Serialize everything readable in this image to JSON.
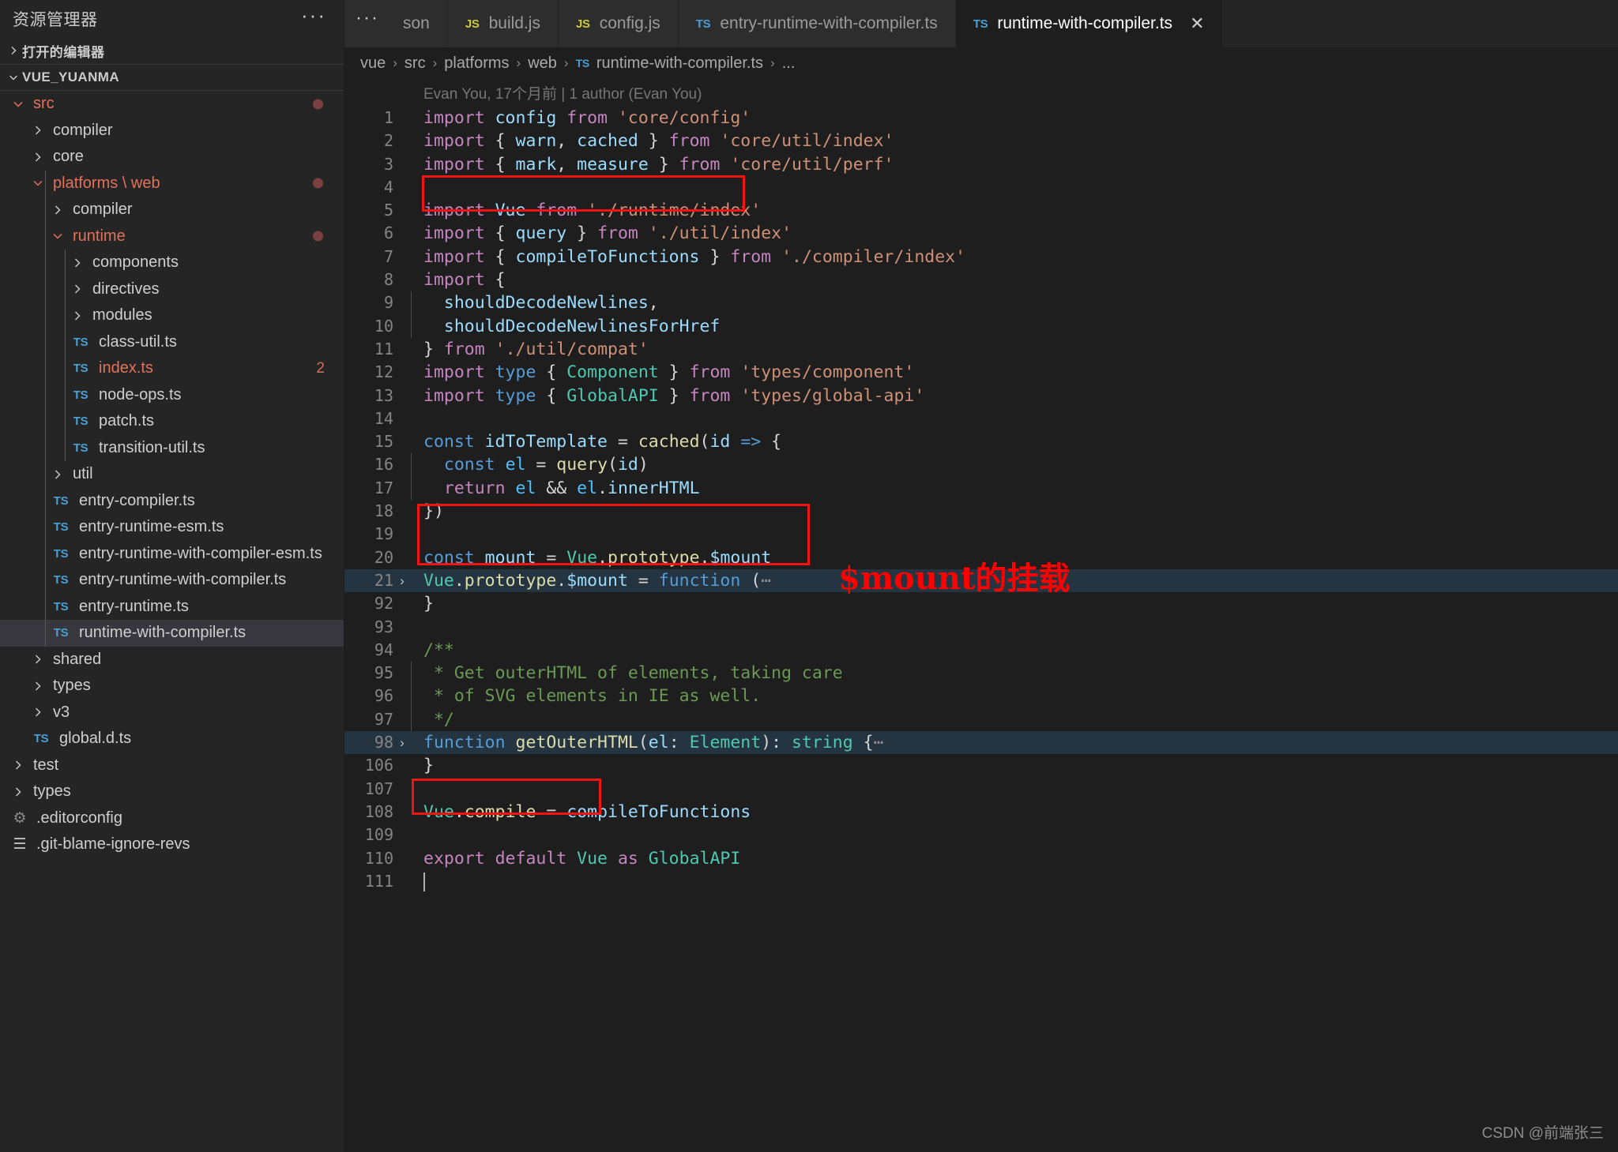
{
  "sidebar": {
    "title": "资源管理器",
    "more_label": "···",
    "open_editors_label": "打开的编辑器",
    "workspace_label": "VUE_YUANMA",
    "tree": [
      {
        "label": "src",
        "type": "folder",
        "expanded": true,
        "indent": 1,
        "modified": true,
        "badge_dot": true
      },
      {
        "label": "compiler",
        "type": "folder",
        "expanded": false,
        "indent": 2
      },
      {
        "label": "core",
        "type": "folder",
        "expanded": false,
        "indent": 2
      },
      {
        "label": "platforms \\ web",
        "type": "folder",
        "expanded": true,
        "indent": 2,
        "modified": true,
        "badge_dot": true
      },
      {
        "label": "compiler",
        "type": "folder",
        "expanded": false,
        "indent": 3
      },
      {
        "label": "runtime",
        "type": "folder",
        "expanded": true,
        "indent": 3,
        "modified": true,
        "badge_dot": true
      },
      {
        "label": "components",
        "type": "folder",
        "expanded": false,
        "indent": 4
      },
      {
        "label": "directives",
        "type": "folder",
        "expanded": false,
        "indent": 4
      },
      {
        "label": "modules",
        "type": "folder",
        "expanded": false,
        "indent": 4
      },
      {
        "label": "class-util.ts",
        "type": "ts",
        "indent": 4
      },
      {
        "label": "index.ts",
        "type": "ts",
        "indent": 4,
        "modified": true,
        "badge_num": "2"
      },
      {
        "label": "node-ops.ts",
        "type": "ts",
        "indent": 4
      },
      {
        "label": "patch.ts",
        "type": "ts",
        "indent": 4
      },
      {
        "label": "transition-util.ts",
        "type": "ts",
        "indent": 4
      },
      {
        "label": "util",
        "type": "folder",
        "expanded": false,
        "indent": 3
      },
      {
        "label": "entry-compiler.ts",
        "type": "ts",
        "indent": 3
      },
      {
        "label": "entry-runtime-esm.ts",
        "type": "ts",
        "indent": 3
      },
      {
        "label": "entry-runtime-with-compiler-esm.ts",
        "type": "ts",
        "indent": 3
      },
      {
        "label": "entry-runtime-with-compiler.ts",
        "type": "ts",
        "indent": 3
      },
      {
        "label": "entry-runtime.ts",
        "type": "ts",
        "indent": 3
      },
      {
        "label": "runtime-with-compiler.ts",
        "type": "ts",
        "indent": 3,
        "selected": true
      },
      {
        "label": "shared",
        "type": "folder",
        "expanded": false,
        "indent": 2
      },
      {
        "label": "types",
        "type": "folder",
        "expanded": false,
        "indent": 2
      },
      {
        "label": "v3",
        "type": "folder",
        "expanded": false,
        "indent": 2
      },
      {
        "label": "global.d.ts",
        "type": "ts",
        "indent": 2
      },
      {
        "label": "test",
        "type": "folder",
        "expanded": false,
        "indent": 1
      },
      {
        "label": "types",
        "type": "folder",
        "expanded": false,
        "indent": 1
      },
      {
        "label": ".editorconfig",
        "type": "gear",
        "indent": 1
      },
      {
        "label": ".git-blame-ignore-revs",
        "type": "lines",
        "indent": 1
      }
    ]
  },
  "tabs": [
    {
      "label": "son",
      "icon": "",
      "active": false,
      "partial": true
    },
    {
      "label": "build.js",
      "icon": "JS",
      "icon_kind": "js",
      "active": false
    },
    {
      "label": "config.js",
      "icon": "JS",
      "icon_kind": "js",
      "active": false
    },
    {
      "label": "entry-runtime-with-compiler.ts",
      "icon": "TS",
      "icon_kind": "ts",
      "active": false
    },
    {
      "label": "runtime-with-compiler.ts",
      "icon": "TS",
      "icon_kind": "ts",
      "active": true,
      "close": "✕"
    }
  ],
  "breadcrumb": {
    "items": [
      "vue",
      "src",
      "platforms",
      "web"
    ],
    "file_icon": "TS",
    "file": "runtime-with-compiler.ts",
    "tail": "...",
    "separator": "›"
  },
  "blame": "Evan You, 17个月前 | 1 author (Evan You)",
  "editor": {
    "lines": [
      {
        "num": "1",
        "tokens": [
          [
            "kw",
            "import "
          ],
          [
            "var",
            "config"
          ],
          [
            "punc",
            " "
          ],
          [
            "kw",
            "from "
          ],
          [
            "str",
            "'core/config'"
          ]
        ]
      },
      {
        "num": "2",
        "tokens": [
          [
            "kw",
            "import "
          ],
          [
            "punc",
            "{ "
          ],
          [
            "var",
            "warn"
          ],
          [
            "punc",
            ", "
          ],
          [
            "var",
            "cached"
          ],
          [
            "punc",
            " } "
          ],
          [
            "kw",
            "from "
          ],
          [
            "str",
            "'core/util/index'"
          ]
        ]
      },
      {
        "num": "3",
        "tokens": [
          [
            "kw",
            "import "
          ],
          [
            "punc",
            "{ "
          ],
          [
            "var",
            "mark"
          ],
          [
            "punc",
            ", "
          ],
          [
            "var",
            "measure"
          ],
          [
            "punc",
            " } "
          ],
          [
            "kw",
            "from "
          ],
          [
            "str",
            "'core/util/perf'"
          ]
        ]
      },
      {
        "num": "4",
        "tokens": []
      },
      {
        "num": "5",
        "tokens": [
          [
            "kw",
            "import "
          ],
          [
            "var",
            "Vue"
          ],
          [
            "punc",
            " "
          ],
          [
            "kw",
            "from "
          ],
          [
            "str",
            "'./runtime/index'"
          ]
        ]
      },
      {
        "num": "6",
        "tokens": [
          [
            "kw",
            "import "
          ],
          [
            "punc",
            "{ "
          ],
          [
            "var",
            "query"
          ],
          [
            "punc",
            " } "
          ],
          [
            "kw",
            "from "
          ],
          [
            "str",
            "'./util/index'"
          ]
        ]
      },
      {
        "num": "7",
        "tokens": [
          [
            "kw",
            "import "
          ],
          [
            "punc",
            "{ "
          ],
          [
            "var",
            "compileToFunctions"
          ],
          [
            "punc",
            " } "
          ],
          [
            "kw",
            "from "
          ],
          [
            "str",
            "'./compiler/index'"
          ]
        ]
      },
      {
        "num": "8",
        "tokens": [
          [
            "kw",
            "import "
          ],
          [
            "punc",
            "{"
          ]
        ]
      },
      {
        "num": "9",
        "tokens": [
          [
            "punc",
            "  "
          ],
          [
            "var",
            "shouldDecodeNewlines"
          ],
          [
            "punc",
            ","
          ]
        ],
        "guide": 1
      },
      {
        "num": "10",
        "tokens": [
          [
            "punc",
            "  "
          ],
          [
            "var",
            "shouldDecodeNewlinesForHref"
          ]
        ],
        "guide": 1
      },
      {
        "num": "11",
        "tokens": [
          [
            "punc",
            "} "
          ],
          [
            "kw",
            "from "
          ],
          [
            "str",
            "'./util/compat'"
          ]
        ]
      },
      {
        "num": "12",
        "tokens": [
          [
            "kw",
            "import "
          ],
          [
            "kw2",
            "type "
          ],
          [
            "punc",
            "{ "
          ],
          [
            "typ",
            "Component"
          ],
          [
            "punc",
            " } "
          ],
          [
            "kw",
            "from "
          ],
          [
            "str",
            "'types/component'"
          ]
        ]
      },
      {
        "num": "13",
        "tokens": [
          [
            "kw",
            "import "
          ],
          [
            "kw2",
            "type "
          ],
          [
            "punc",
            "{ "
          ],
          [
            "typ",
            "GlobalAPI"
          ],
          [
            "punc",
            " } "
          ],
          [
            "kw",
            "from "
          ],
          [
            "str",
            "'types/global-api'"
          ]
        ]
      },
      {
        "num": "14",
        "tokens": []
      },
      {
        "num": "15",
        "tokens": [
          [
            "kw2",
            "const "
          ],
          [
            "var",
            "idToTemplate"
          ],
          [
            "punc",
            " = "
          ],
          [
            "fn",
            "cached"
          ],
          [
            "punc",
            "("
          ],
          [
            "var",
            "id"
          ],
          [
            "punc",
            " "
          ],
          [
            "kw2",
            "=> "
          ],
          [
            "punc",
            "{"
          ]
        ]
      },
      {
        "num": "16",
        "tokens": [
          [
            "punc",
            "  "
          ],
          [
            "kw2",
            "const "
          ],
          [
            "el",
            "el"
          ],
          [
            "punc",
            " = "
          ],
          [
            "fn",
            "query"
          ],
          [
            "punc",
            "("
          ],
          [
            "var",
            "id"
          ],
          [
            "punc",
            ")"
          ]
        ],
        "guide": 1
      },
      {
        "num": "17",
        "tokens": [
          [
            "punc",
            "  "
          ],
          [
            "kw",
            "return "
          ],
          [
            "el",
            "el"
          ],
          [
            "punc",
            " && "
          ],
          [
            "el",
            "el"
          ],
          [
            "punc",
            "."
          ],
          [
            "var",
            "innerHTML"
          ]
        ],
        "guide": 1
      },
      {
        "num": "18",
        "tokens": [
          [
            "punc",
            "})"
          ]
        ]
      },
      {
        "num": "19",
        "tokens": []
      },
      {
        "num": "20",
        "tokens": [
          [
            "kw2",
            "const "
          ],
          [
            "var",
            "mount"
          ],
          [
            "punc",
            " = "
          ],
          [
            "cls",
            "Vue"
          ],
          [
            "punc",
            "."
          ],
          [
            "fn",
            "prototype"
          ],
          [
            "punc",
            "."
          ],
          [
            "var",
            "$mount"
          ]
        ]
      },
      {
        "num": "21",
        "tokens": [
          [
            "cls",
            "Vue"
          ],
          [
            "punc",
            "."
          ],
          [
            "fn",
            "prototype"
          ],
          [
            "punc",
            "."
          ],
          [
            "var",
            "$mount"
          ],
          [
            "punc",
            " = "
          ],
          [
            "kw2",
            "function "
          ],
          [
            "punc",
            "("
          ],
          [
            "dots",
            "⋯"
          ]
        ],
        "fold": "›",
        "highlight": true
      },
      {
        "num": "92",
        "tokens": [
          [
            "punc",
            "}"
          ]
        ]
      },
      {
        "num": "93",
        "tokens": []
      },
      {
        "num": "94",
        "tokens": [
          [
            "cmt",
            "/**"
          ]
        ]
      },
      {
        "num": "95",
        "tokens": [
          [
            "cmt",
            " * Get outerHTML of elements, taking care"
          ]
        ],
        "guide": 1
      },
      {
        "num": "96",
        "tokens": [
          [
            "cmt",
            " * of SVG elements in IE as well."
          ]
        ],
        "guide": 1
      },
      {
        "num": "97",
        "tokens": [
          [
            "cmt",
            " */"
          ]
        ],
        "guide": 1
      },
      {
        "num": "98",
        "tokens": [
          [
            "kw2",
            "function "
          ],
          [
            "fn",
            "getOuterHTML"
          ],
          [
            "punc",
            "("
          ],
          [
            "var",
            "el"
          ],
          [
            "punc",
            ": "
          ],
          [
            "typ",
            "Element"
          ],
          [
            "punc",
            "): "
          ],
          [
            "typ",
            "string"
          ],
          [
            "punc",
            " {"
          ],
          [
            "dots",
            "⋯"
          ]
        ],
        "fold": "›",
        "highlight": true
      },
      {
        "num": "106",
        "tokens": [
          [
            "punc",
            "}"
          ]
        ]
      },
      {
        "num": "107",
        "tokens": []
      },
      {
        "num": "108",
        "tokens": [
          [
            "cls",
            "Vue"
          ],
          [
            "punc",
            "."
          ],
          [
            "fn",
            "compile"
          ],
          [
            "punc",
            " = "
          ],
          [
            "var",
            "compileToFunctions"
          ]
        ]
      },
      {
        "num": "109",
        "tokens": []
      },
      {
        "num": "110",
        "tokens": [
          [
            "kw",
            "export default "
          ],
          [
            "cls",
            "Vue"
          ],
          [
            "kw",
            " as "
          ],
          [
            "typ",
            "GlobalAPI"
          ]
        ]
      },
      {
        "num": "111",
        "tokens": [],
        "cursor": true
      }
    ]
  },
  "annotations": {
    "mount_note": "$mount的挂载",
    "red_boxes": 3
  },
  "watermark": "CSDN @前端张三",
  "colors": {
    "accent_red": "#f01414",
    "editor_bg": "#1e1e1e",
    "sidebar_bg": "#252526",
    "selection_bg": "#37373d",
    "fold_highlight": "#243441"
  }
}
